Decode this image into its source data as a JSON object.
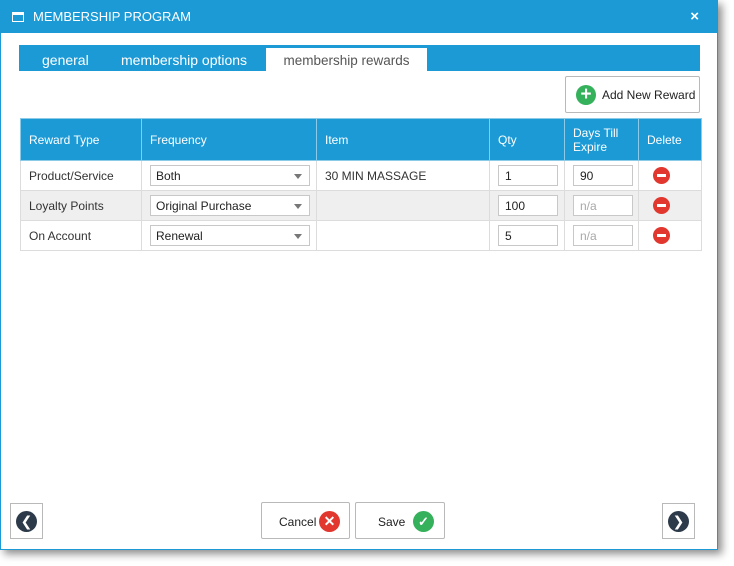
{
  "window": {
    "title": "MEMBERSHIP PROGRAM",
    "close_label": "×"
  },
  "tabs": [
    {
      "label": "general"
    },
    {
      "label": "membership options"
    },
    {
      "label": "membership rewards",
      "active": true
    }
  ],
  "toolbar": {
    "add_label": "Add New Reward"
  },
  "table": {
    "headers": [
      "Reward Type",
      "Frequency",
      "Item",
      "Qty",
      "Days Till Expire",
      "Delete"
    ],
    "rows": [
      {
        "reward_type": "Product/Service",
        "frequency": "Both",
        "item": "30 MIN MASSAGE",
        "qty": "1",
        "days": "90",
        "days_placeholder": ""
      },
      {
        "reward_type": "Loyalty Points",
        "frequency": "Original Purchase",
        "item": "",
        "qty": "100",
        "days": "",
        "days_placeholder": "n/a"
      },
      {
        "reward_type": "On Account",
        "frequency": "Renewal",
        "item": "",
        "qty": "5",
        "days": "",
        "days_placeholder": "n/a"
      }
    ]
  },
  "footer": {
    "cancel_label": "Cancel",
    "save_label": "Save"
  },
  "icons": {
    "window": "window-icon",
    "add": "plus-circle-icon",
    "delete": "minus-circle-icon",
    "cancel": "x-circle-icon",
    "save": "check-circle-icon",
    "prev": "chevron-left-icon",
    "next": "chevron-right-icon"
  },
  "colors": {
    "accent": "#1b9ad6",
    "add": "#34b15a",
    "delete": "#e2372e",
    "nav": "#2d3a4a"
  }
}
